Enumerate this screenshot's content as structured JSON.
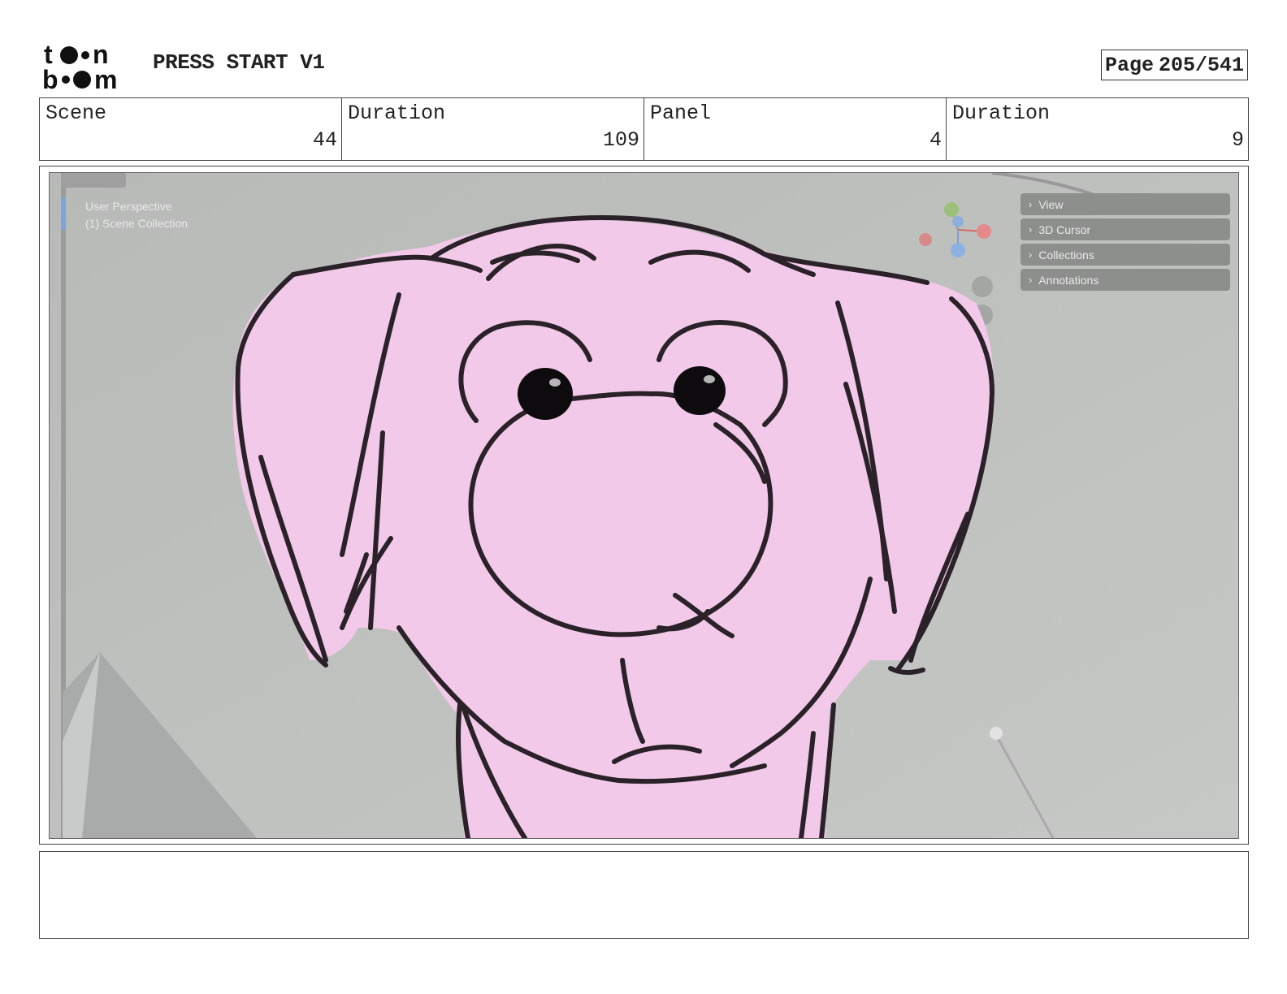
{
  "header": {
    "logo_text": "toon boom",
    "project_title": "PRESS START V1",
    "page_label": "Page",
    "page_number": "205/541"
  },
  "info": {
    "scene_label": "Scene",
    "scene_value": "44",
    "scene_duration_label": "Duration",
    "scene_duration_value": "109",
    "panel_label": "Panel",
    "panel_value": "4",
    "panel_duration_label": "Duration",
    "panel_duration_value": "9"
  },
  "viewport": {
    "perspective_label": "User Perspective",
    "collection_label": "(1) Scene Collection",
    "n_panel_items": [
      "View",
      "3D Cursor",
      "Collections",
      "Annotations"
    ],
    "gizmo_axes": [
      "Z",
      "X",
      "Y"
    ]
  },
  "colors": {
    "viewport_bg": "#bfc1bf",
    "sketch_fill": "#f2c9e8",
    "sketch_stroke": "#2a2228"
  },
  "notes": {
    "text": ""
  }
}
